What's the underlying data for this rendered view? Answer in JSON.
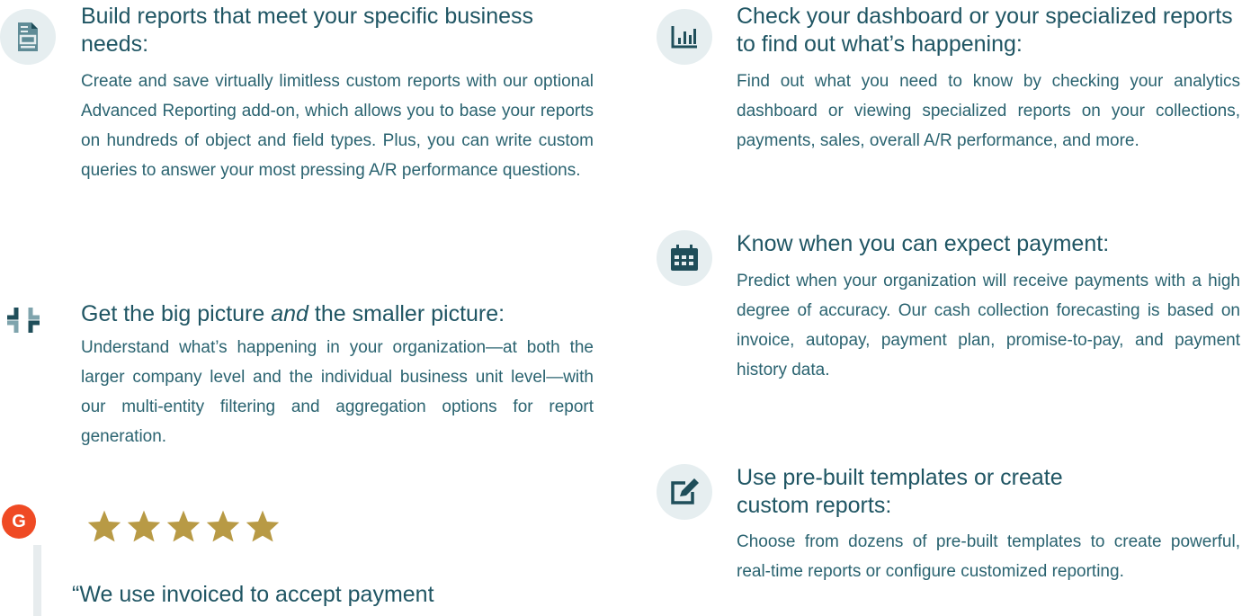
{
  "left": {
    "reports": {
      "title": "Build reports that meet your specific business needs:",
      "body": "Create and save virtually limitless custom reports with our optional Advanced Reporting add-on, which allows you to base your reports on hundreds of object and field types. Plus, you can write custom queries to answer your most pressing A/R performance questions."
    },
    "picture": {
      "title_a": "Get the big picture ",
      "title_em": "and",
      "title_b": " the smaller picture:",
      "body": "Understand what’s happening in your organization—at both the larger company level and the individual business unit level—with our multi-entity filtering and aggregation options for report generation."
    },
    "review": {
      "badge": "G",
      "stars": 5,
      "quote": "“We use invoiced to accept payment"
    }
  },
  "right": {
    "dashboard": {
      "title": "Check your dashboard or your specialized reports to find out what’s happening:",
      "body": "Find out what you need to know by checking your analytics dashboard or viewing specialized reports on your collections, payments, sales, overall A/R performance, and more."
    },
    "payment": {
      "title": "Know when you can expect payment:",
      "body": "Predict when your organization will receive payments with a high degree of accuracy. Our cash collection forecasting is based on invoice, autopay, payment plan, promise-to-pay, and payment history data."
    },
    "templates": {
      "title": "Use pre-built templates or create custom reports:",
      "body": "Choose from dozens of pre-built templates to create powerful, real-time reports or configure customized reporting."
    }
  },
  "colors": {
    "icon_bg": "#e6eef0",
    "icon_fg": "#1f5563",
    "text": "#1f5563",
    "g2": "#ef4a24",
    "star": "#b89a45"
  }
}
